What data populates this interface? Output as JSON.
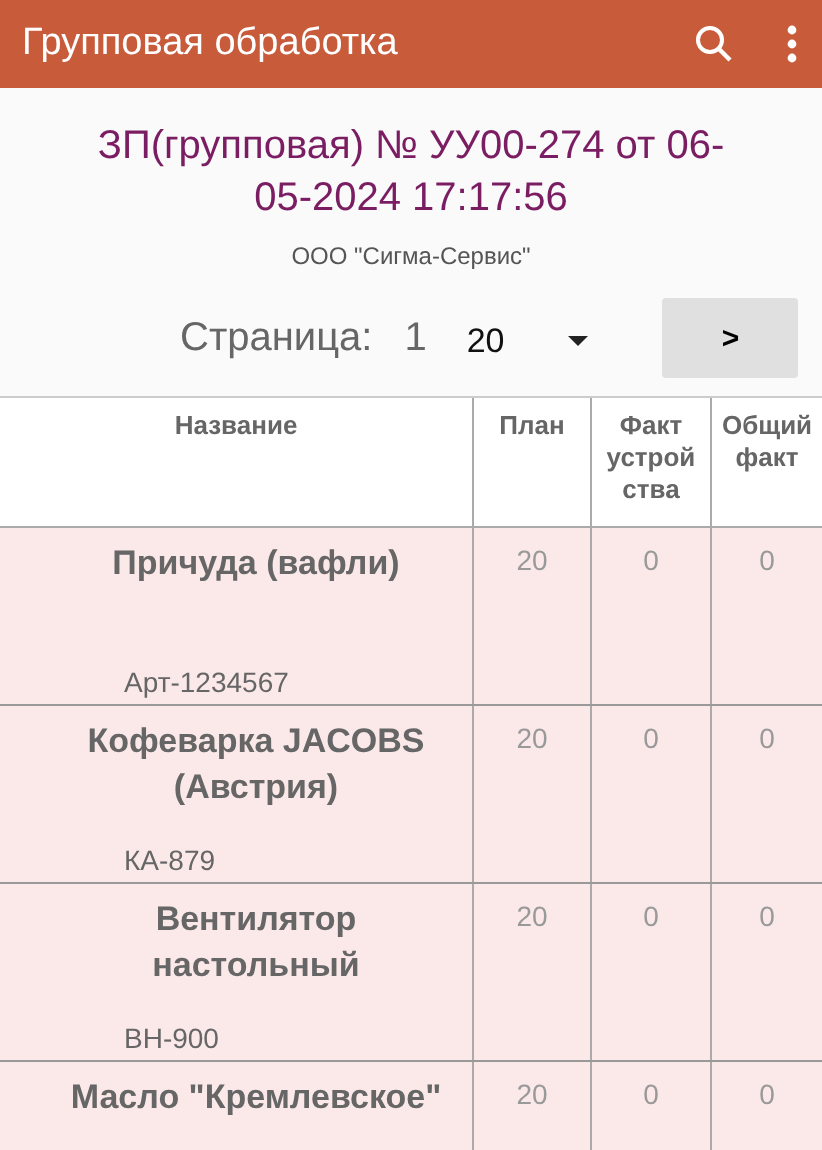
{
  "app_bar": {
    "title": "Групповая обработка"
  },
  "document": {
    "title": "ЗП(групповая) № УУ00-274 от 06-05-2024 17:17:56",
    "company": "ООО \"Сигма-Сервис\""
  },
  "pager": {
    "label": "Страница:",
    "page": "1",
    "page_size": "20",
    "next_button": ">"
  },
  "table": {
    "columns": [
      "Название",
      "План",
      "Факт устрой ства",
      "Общий факт"
    ],
    "rows": [
      {
        "name": "Причуда (вафли)",
        "article": "Арт-1234567",
        "plan": "20",
        "device_fact": "0",
        "total_fact": "0"
      },
      {
        "name": "Кофеварка JACOBS (Австрия)",
        "article": "КА-879",
        "plan": "20",
        "device_fact": "0",
        "total_fact": "0"
      },
      {
        "name": "Вентилятор настольный",
        "article": "ВН-900",
        "plan": "20",
        "device_fact": "0",
        "total_fact": "0"
      },
      {
        "name": "Масло \"Кремлевское\"",
        "plan": "20",
        "device_fact": "0",
        "total_fact": "0"
      }
    ]
  }
}
